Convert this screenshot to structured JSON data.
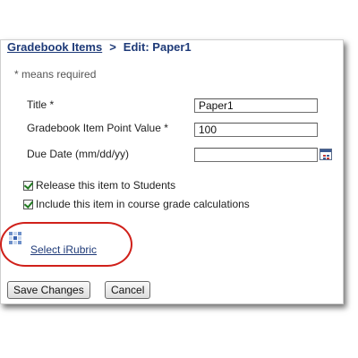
{
  "breadcrumb": {
    "link": "Gradebook Items",
    "separator": ">",
    "current": "Edit: Paper1"
  },
  "required_note": "* means required",
  "form": {
    "title_label": "Title *",
    "title_value": "Paper1",
    "points_label": "Gradebook Item Point Value *",
    "points_value": "100",
    "due_label": "Due Date (mm/dd/yy)",
    "due_value": ""
  },
  "checks": {
    "release_label": "Release this item to Students",
    "release_checked": true,
    "include_label": "Include this item in course grade calculations",
    "include_checked": true
  },
  "rubric": {
    "link_label": "Select iRubric",
    "icon": "rubric-grid-icon"
  },
  "buttons": {
    "save": "Save Changes",
    "cancel": "Cancel"
  },
  "colors": {
    "link": "#1e3a78",
    "highlight_circle": "#d0201a"
  }
}
